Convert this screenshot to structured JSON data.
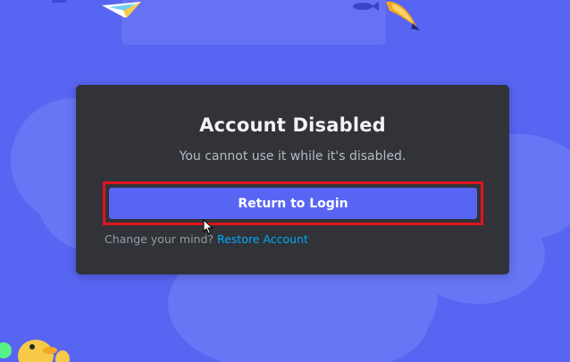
{
  "dialog": {
    "title": "Account Disabled",
    "subtitle": "You cannot use it while it's disabled.",
    "primary_button_label": "Return to Login",
    "footer_prompt": "Change your mind?",
    "footer_link": "Restore Account"
  },
  "colors": {
    "background": "#5865f2",
    "modal": "#313338",
    "button": "#5865f2",
    "link": "#00a8fc",
    "highlight_outline": "#e0141e"
  },
  "icons": [
    "mouse-cursor-icon"
  ]
}
